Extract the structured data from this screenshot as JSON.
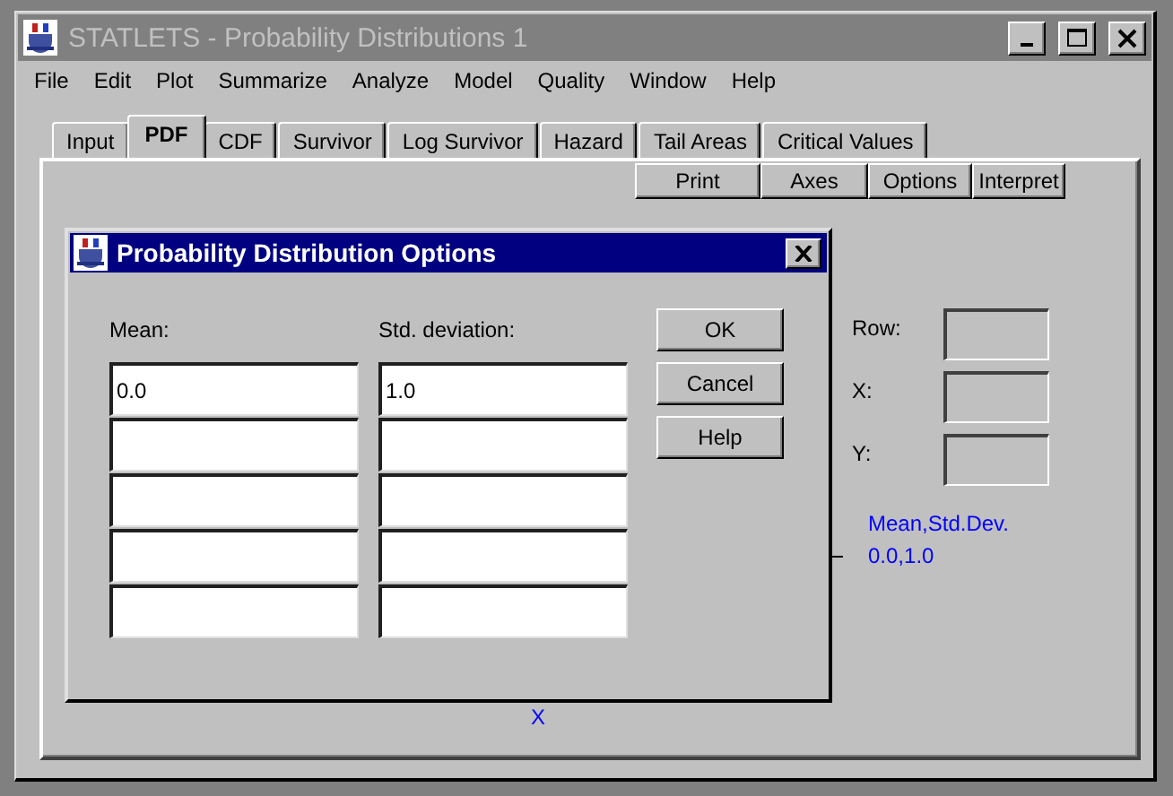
{
  "window": {
    "title": "STATLETS - Probability Distributions 1",
    "active": false
  },
  "menu": [
    "File",
    "Edit",
    "Plot",
    "Summarize",
    "Analyze",
    "Model",
    "Quality",
    "Window",
    "Help"
  ],
  "tabs": [
    {
      "label": "Input",
      "selected": false
    },
    {
      "label": "PDF",
      "selected": true
    },
    {
      "label": "CDF",
      "selected": false
    },
    {
      "label": "Survivor",
      "selected": false
    },
    {
      "label": "Log Survivor",
      "selected": false
    },
    {
      "label": "Hazard",
      "selected": false
    },
    {
      "label": "Tail Areas",
      "selected": false
    },
    {
      "label": "Critical Values",
      "selected": false
    }
  ],
  "toolbar": [
    "Print",
    "Axes",
    "Options",
    "Interpret"
  ],
  "dialog": {
    "title": "Probability Distribution Options",
    "columns": [
      "Mean:",
      "Std. deviation:"
    ],
    "rows": [
      {
        "kind": "filled",
        "values": [
          "0.0",
          "1.0"
        ]
      },
      {
        "kind": "empty"
      },
      {
        "kind": "empty"
      },
      {
        "kind": "empty"
      },
      {
        "kind": "empty"
      }
    ],
    "buttons": [
      "OK",
      "Cancel",
      "Help"
    ]
  },
  "readouts": [
    {
      "label": "Row:"
    },
    {
      "label": "X:"
    },
    {
      "label": "Y:"
    }
  ],
  "legend": {
    "title": "Mean,Std.Dev.",
    "value": "0.0,1.0"
  },
  "x_axis_label": "X"
}
